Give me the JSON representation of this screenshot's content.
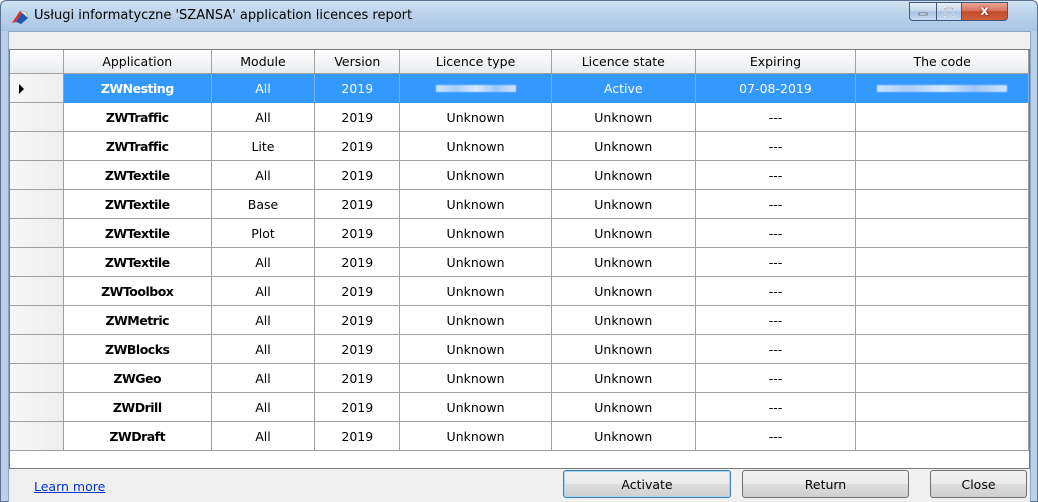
{
  "window": {
    "title": "Usługi informatyczne 'SZANSA' application licences report",
    "close_glyph": "x"
  },
  "grid": {
    "columns": [
      "Application",
      "Module",
      "Version",
      "Licence type",
      "Licence state",
      "Expiring",
      "The code"
    ],
    "rows": [
      {
        "application": "ZWNesting",
        "module": "All",
        "version": "2019",
        "licence_type": "",
        "licence_state": "Active",
        "expiring": "07-08-2019",
        "code": "",
        "selected": true,
        "redacted": true
      },
      {
        "application": "ZWTraffic",
        "module": "All",
        "version": "2019",
        "licence_type": "Unknown",
        "licence_state": "Unknown",
        "expiring": "---",
        "code": ""
      },
      {
        "application": "ZWTraffic",
        "module": "Lite",
        "version": "2019",
        "licence_type": "Unknown",
        "licence_state": "Unknown",
        "expiring": "---",
        "code": ""
      },
      {
        "application": "ZWTextile",
        "module": "All",
        "version": "2019",
        "licence_type": "Unknown",
        "licence_state": "Unknown",
        "expiring": "---",
        "code": ""
      },
      {
        "application": "ZWTextile",
        "module": "Base",
        "version": "2019",
        "licence_type": "Unknown",
        "licence_state": "Unknown",
        "expiring": "---",
        "code": ""
      },
      {
        "application": "ZWTextile",
        "module": "Plot",
        "version": "2019",
        "licence_type": "Unknown",
        "licence_state": "Unknown",
        "expiring": "---",
        "code": ""
      },
      {
        "application": "ZWTextile",
        "module": "All",
        "version": "2019",
        "licence_type": "Unknown",
        "licence_state": "Unknown",
        "expiring": "---",
        "code": ""
      },
      {
        "application": "ZWToolbox",
        "module": "All",
        "version": "2019",
        "licence_type": "Unknown",
        "licence_state": "Unknown",
        "expiring": "---",
        "code": ""
      },
      {
        "application": "ZWMetric",
        "module": "All",
        "version": "2019",
        "licence_type": "Unknown",
        "licence_state": "Unknown",
        "expiring": "---",
        "code": ""
      },
      {
        "application": "ZWBlocks",
        "module": "All",
        "version": "2019",
        "licence_type": "Unknown",
        "licence_state": "Unknown",
        "expiring": "---",
        "code": ""
      },
      {
        "application": "ZWGeo",
        "module": "All",
        "version": "2019",
        "licence_type": "Unknown",
        "licence_state": "Unknown",
        "expiring": "---",
        "code": ""
      },
      {
        "application": "ZWDrill",
        "module": "All",
        "version": "2019",
        "licence_type": "Unknown",
        "licence_state": "Unknown",
        "expiring": "---",
        "code": ""
      },
      {
        "application": "ZWDraft",
        "module": "All",
        "version": "2019",
        "licence_type": "Unknown",
        "licence_state": "Unknown",
        "expiring": "---",
        "code": ""
      }
    ]
  },
  "footer": {
    "learn_more": "Learn more",
    "activate": "Activate",
    "return": "Return",
    "close": "Close"
  },
  "colors": {
    "selection": "#3399ff",
    "link": "#0033cc"
  }
}
